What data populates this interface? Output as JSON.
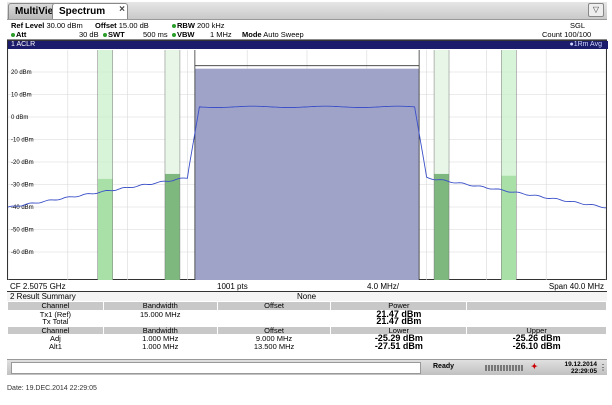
{
  "tabs": {
    "multiview": "MultiView",
    "spectrum": "Spectrum",
    "close": "×",
    "dropdown": "▽"
  },
  "header": {
    "ref_level_label": "Ref Level",
    "ref_level": "30.00 dBm",
    "offset_label": "Offset",
    "offset": "15.00 dB",
    "rbw_label": "RBW",
    "rbw": "200 kHz",
    "att_label": "Att",
    "att": "30 dB",
    "swt_label": "SWT",
    "swt": "500 ms",
    "vbw_label": "VBW",
    "vbw": "1 MHz",
    "mode_label": "Mode",
    "mode": "Auto Sweep",
    "sgl": "SGL",
    "count": "Count 100/100"
  },
  "plot": {
    "title": "1 ACLR",
    "trace_label": "●1Rm Avg",
    "y_ticks": [
      "20 dBm",
      "10 dBm",
      "0 dBm",
      "-10 dBm",
      "-20 dBm",
      "-30 dBm",
      "-40 dBm",
      "-50 dBm",
      "-60 dBm"
    ],
    "y_values": [
      20,
      10,
      0,
      -10,
      -20,
      -30,
      -40,
      -50,
      -60
    ],
    "cf": "CF 2.5075 GHz",
    "pts": "1001 pts",
    "div": "4.0 MHz/",
    "span": "Span 40.0 MHz"
  },
  "results": {
    "title": "2 Result Summary",
    "none": "None",
    "h1": {
      "channel": "Channel",
      "bandwidth": "Bandwidth",
      "offset": "Offset",
      "power": "Power"
    },
    "tx1": {
      "channel": "Tx1 (Ref)",
      "bandwidth": "15.000 MHz",
      "power": "21.47 dBm"
    },
    "txtotal": {
      "channel": "Tx Total",
      "power": "21.47 dBm"
    },
    "h2": {
      "channel": "Channel",
      "bandwidth": "Bandwidth",
      "offset": "Offset",
      "lower": "Lower",
      "upper": "Upper"
    },
    "adj": {
      "channel": "Adj",
      "bandwidth": "1.000 MHz",
      "offset": "9.000 MHz",
      "lower": "-25.29 dBm",
      "upper": "-25.26 dBm"
    },
    "alt1": {
      "channel": "Alt1",
      "bandwidth": "1.000 MHz",
      "offset": "13.500 MHz",
      "lower": "-27.51 dBm",
      "upper": "-26.10 dBm"
    }
  },
  "status": {
    "ready": "Ready",
    "date": "19.12.2014",
    "time": "22:29:05",
    "dots": "⋮"
  },
  "footer": {
    "date": "Date: 19.DEC.2014  22:29:05"
  },
  "colors": {
    "tx_fill": "#9fa3c8",
    "trace": "#3a4fc8",
    "adj_band": "#7fb87f",
    "alt_band": "#c8f0c8",
    "title_bar": "#1c1c6c"
  }
}
